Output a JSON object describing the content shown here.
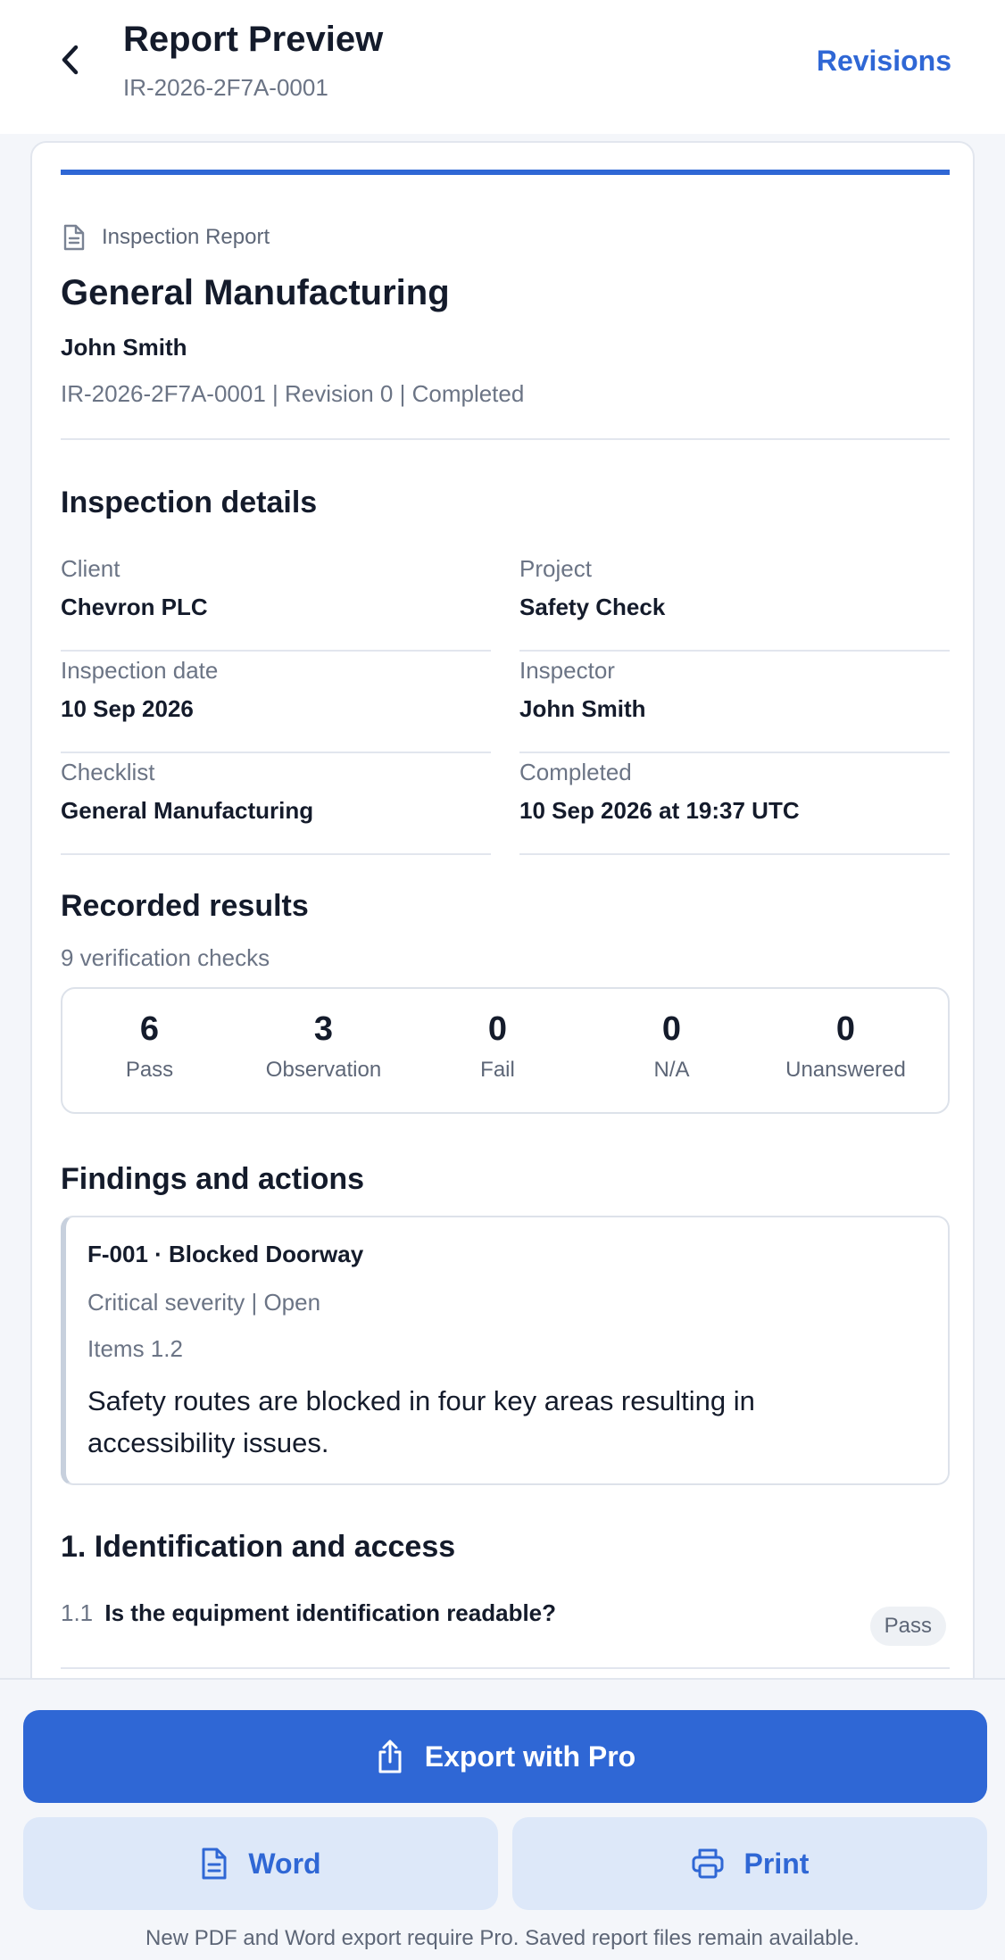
{
  "header": {
    "title": "Report Preview",
    "subtitle": "IR-2026-2F7A-0001",
    "revisions_label": "Revisions",
    "back_icon": "chevron-left-icon"
  },
  "report": {
    "type_label": "Inspection Report",
    "type_icon": "document-icon",
    "title": "General Manufacturing",
    "author": "John Smith",
    "meta": "IR-2026-2F7A-0001 | Revision 0 | Completed"
  },
  "details": {
    "heading": "Inspection details",
    "fields": [
      {
        "label": "Client",
        "value": "Chevron PLC"
      },
      {
        "label": "Project",
        "value": "Safety Check"
      },
      {
        "label": "Inspection date",
        "value": "10 Sep 2026"
      },
      {
        "label": "Inspector",
        "value": "John Smith"
      },
      {
        "label": "Checklist",
        "value": "General Manufacturing"
      },
      {
        "label": "Completed",
        "value": "10 Sep 2026 at 19:37 UTC"
      }
    ]
  },
  "results": {
    "heading": "Recorded results",
    "subtitle": "9 verification checks",
    "stats": [
      {
        "value": "6",
        "label": "Pass"
      },
      {
        "value": "3",
        "label": "Observation"
      },
      {
        "value": "0",
        "label": "Fail"
      },
      {
        "value": "0",
        "label": "N/A"
      },
      {
        "value": "0",
        "label": "Unanswered"
      }
    ]
  },
  "findings": {
    "heading": "Findings and actions",
    "items": [
      {
        "title": "F-001 · Blocked Doorway",
        "severity": "Critical severity | Open",
        "items": "Items 1.2",
        "description": "Safety routes are blocked in four key areas resulting in accessibility issues."
      }
    ]
  },
  "section1": {
    "heading": "1. Identification and access",
    "questions": [
      {
        "number": "1.1",
        "text": "Is the equipment identification readable?",
        "result": "Pass"
      }
    ]
  },
  "actions": {
    "export_label": "Export with Pro",
    "export_icon": "share-upload-icon",
    "word_label": "Word",
    "word_icon": "document-icon",
    "print_label": "Print",
    "print_icon": "printer-icon",
    "footnote": "New PDF and Word export require Pro. Saved report files remain available."
  },
  "colors": {
    "accent": "#2f67d5",
    "secondary_button_bg": "#dde8f9"
  }
}
